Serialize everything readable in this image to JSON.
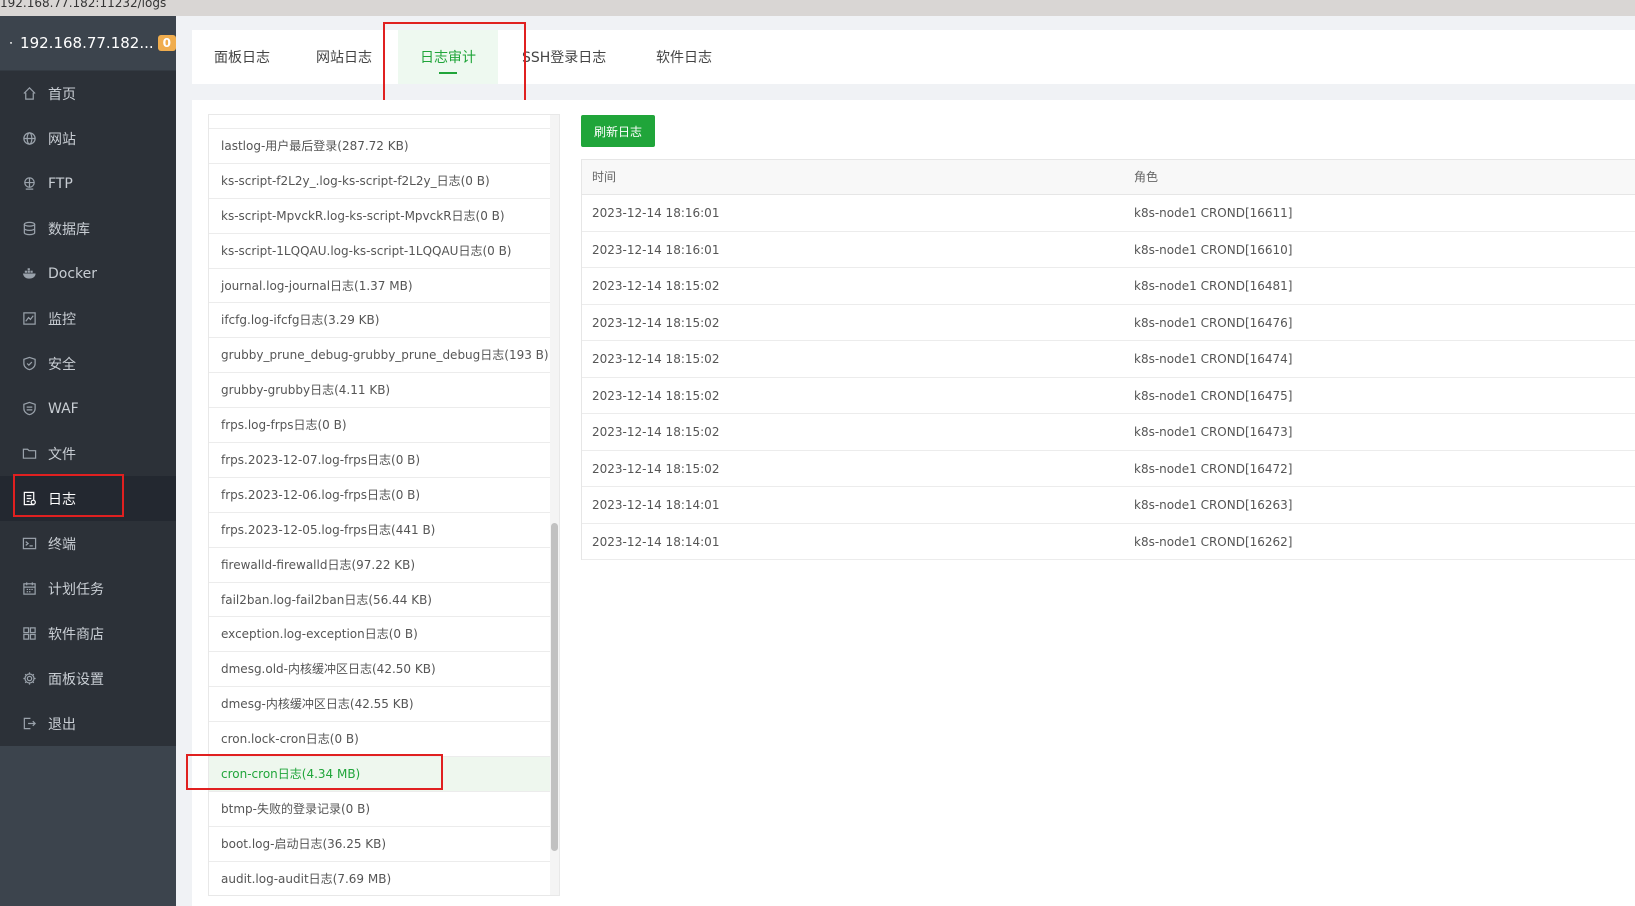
{
  "url_fragment": "192.168.77.182:11232/logs",
  "sidebar": {
    "server_ip": "192.168.77.182...",
    "badge_count": "0",
    "items": [
      {
        "label": "首页",
        "icon": "home-icon"
      },
      {
        "label": "网站",
        "icon": "globe-icon"
      },
      {
        "label": "FTP",
        "icon": "ftp-icon"
      },
      {
        "label": "数据库",
        "icon": "database-icon"
      },
      {
        "label": "Docker",
        "icon": "docker-icon"
      },
      {
        "label": "监控",
        "icon": "monitor-icon"
      },
      {
        "label": "安全",
        "icon": "shield-check-icon"
      },
      {
        "label": "WAF",
        "icon": "waf-shield-icon"
      },
      {
        "label": "文件",
        "icon": "folder-icon"
      },
      {
        "label": "日志",
        "icon": "log-icon",
        "active": true
      },
      {
        "label": "终端",
        "icon": "terminal-icon"
      },
      {
        "label": "计划任务",
        "icon": "calendar-icon"
      },
      {
        "label": "软件商店",
        "icon": "app-grid-icon"
      },
      {
        "label": "面板设置",
        "icon": "gear-icon"
      },
      {
        "label": "退出",
        "icon": "logout-icon"
      }
    ]
  },
  "tabs": [
    {
      "label": "面板日志"
    },
    {
      "label": "网站日志"
    },
    {
      "label": "日志审计",
      "active": true
    },
    {
      "label": "SSH登录日志"
    },
    {
      "label": "软件日志"
    }
  ],
  "log_files": [
    "lastlog-用户最后登录(287.72 KB)",
    "ks-script-f2L2y_.log-ks-script-f2L2y_日志(0 B)",
    "ks-script-MpvckR.log-ks-script-MpvckR日志(0 B)",
    "ks-script-1LQQAU.log-ks-script-1LQQAU日志(0 B)",
    "journal.log-journal日志(1.37 MB)",
    "ifcfg.log-ifcfg日志(3.29 KB)",
    "grubby_prune_debug-grubby_prune_debug日志(193 B)",
    "grubby-grubby日志(4.11 KB)",
    "frps.log-frps日志(0 B)",
    "frps.2023-12-07.log-frps日志(0 B)",
    "frps.2023-12-06.log-frps日志(0 B)",
    "frps.2023-12-05.log-frps日志(441 B)",
    "firewalld-firewalld日志(97.22 KB)",
    "fail2ban.log-fail2ban日志(56.44 KB)",
    "exception.log-exception日志(0 B)",
    "dmesg.old-内核缓冲区日志(42.50 KB)",
    "dmesg-内核缓冲区日志(42.55 KB)",
    "cron.lock-cron日志(0 B)",
    "cron-cron日志(4.34 MB)",
    "btmp-失败的登录记录(0 B)",
    "boot.log-启动日志(36.25 KB)",
    "audit.log-audit日志(7.69 MB)"
  ],
  "selected_file_index": 18,
  "refresh_button": "刷新日志",
  "log_table": {
    "headers": [
      "时间",
      "角色"
    ],
    "rows": [
      [
        "2023-12-14 18:16:01",
        "k8s-node1 CROND[16611]"
      ],
      [
        "2023-12-14 18:16:01",
        "k8s-node1 CROND[16610]"
      ],
      [
        "2023-12-14 18:15:02",
        "k8s-node1 CROND[16481]"
      ],
      [
        "2023-12-14 18:15:02",
        "k8s-node1 CROND[16476]"
      ],
      [
        "2023-12-14 18:15:02",
        "k8s-node1 CROND[16474]"
      ],
      [
        "2023-12-14 18:15:02",
        "k8s-node1 CROND[16475]"
      ],
      [
        "2023-12-14 18:15:02",
        "k8s-node1 CROND[16473]"
      ],
      [
        "2023-12-14 18:15:02",
        "k8s-node1 CROND[16472]"
      ],
      [
        "2023-12-14 18:14:01",
        "k8s-node1 CROND[16263]"
      ],
      [
        "2023-12-14 18:14:01",
        "k8s-node1 CROND[16262]"
      ]
    ]
  },
  "colors": {
    "accent": "#20a53a",
    "sidebar_bg": "#2c3138",
    "highlight_box": "#e02020",
    "badge": "#f0ad4e"
  }
}
